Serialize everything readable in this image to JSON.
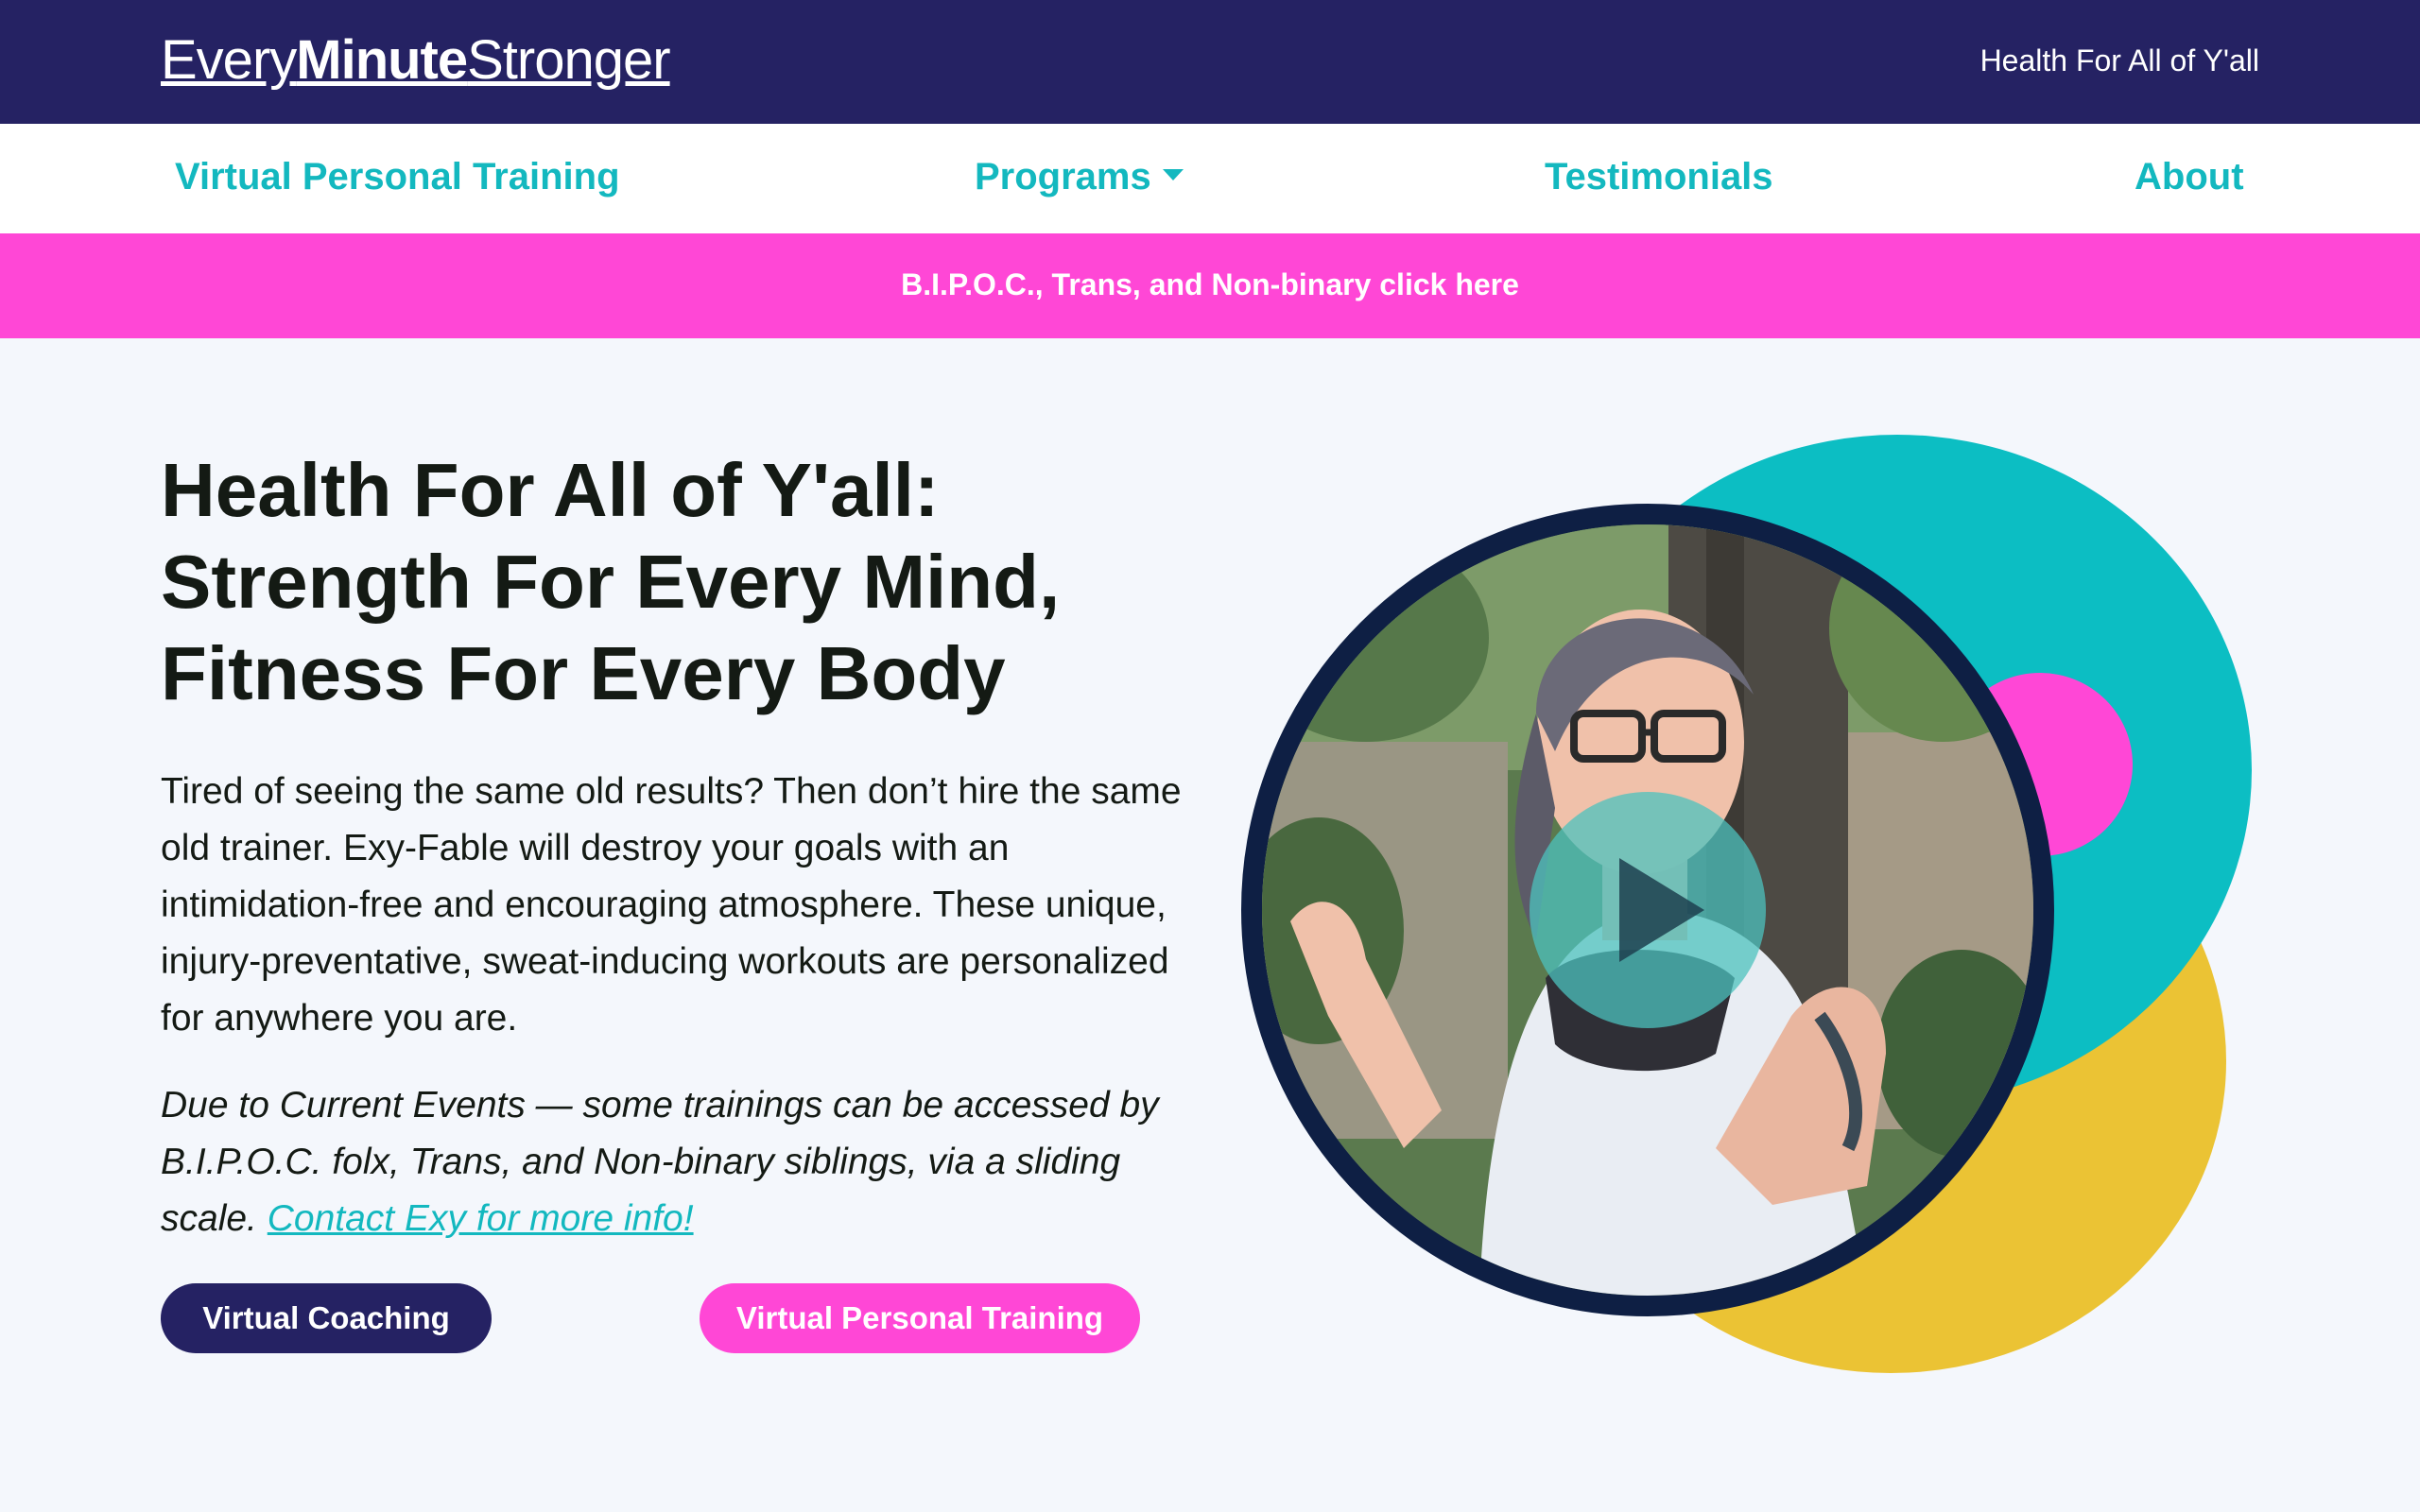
{
  "header": {
    "logo": {
      "part1": "Every",
      "part2": "Minute",
      "part3": "Stronger"
    },
    "tagline": "Health For All of Y'all"
  },
  "nav": {
    "items": [
      {
        "label": "Virtual Personal Training"
      },
      {
        "label": "Programs"
      },
      {
        "label": "Testimonials"
      },
      {
        "label": "About"
      }
    ]
  },
  "banner": {
    "text": "B.I.P.O.C., Trans, and Non-binary click here"
  },
  "hero": {
    "title_lines": [
      "Health For All of Y'all:",
      "Strength For Every Mind,",
      "Fitness For Every Body"
    ],
    "intro": "Tired of seeing the same old results? Then don’t hire the same old trainer. Exy-Fable will destroy your goals with an intimidation-free and encouraging atmosphere. These unique, injury-preventative, sweat-inducing workouts are personalized for anywhere you are.",
    "notice": "Due to Current Events — some trainings can be accessed by B.I.P.O.C. folx, Trans, and Non-binary siblings, via a sliding scale.",
    "notice_link": "Contact Exy for more info!",
    "buttons": {
      "coaching": "Virtual Coaching",
      "vpt": "Virtual Personal Training"
    }
  },
  "colors": {
    "navy": "#252263",
    "teal": "#13b8bf",
    "pink": "#ff47d6",
    "yellow": "#ebc334",
    "circle_border": "#0e1f44"
  },
  "icons": {
    "play": "play-icon",
    "dropdown": "chevron-down-icon"
  }
}
